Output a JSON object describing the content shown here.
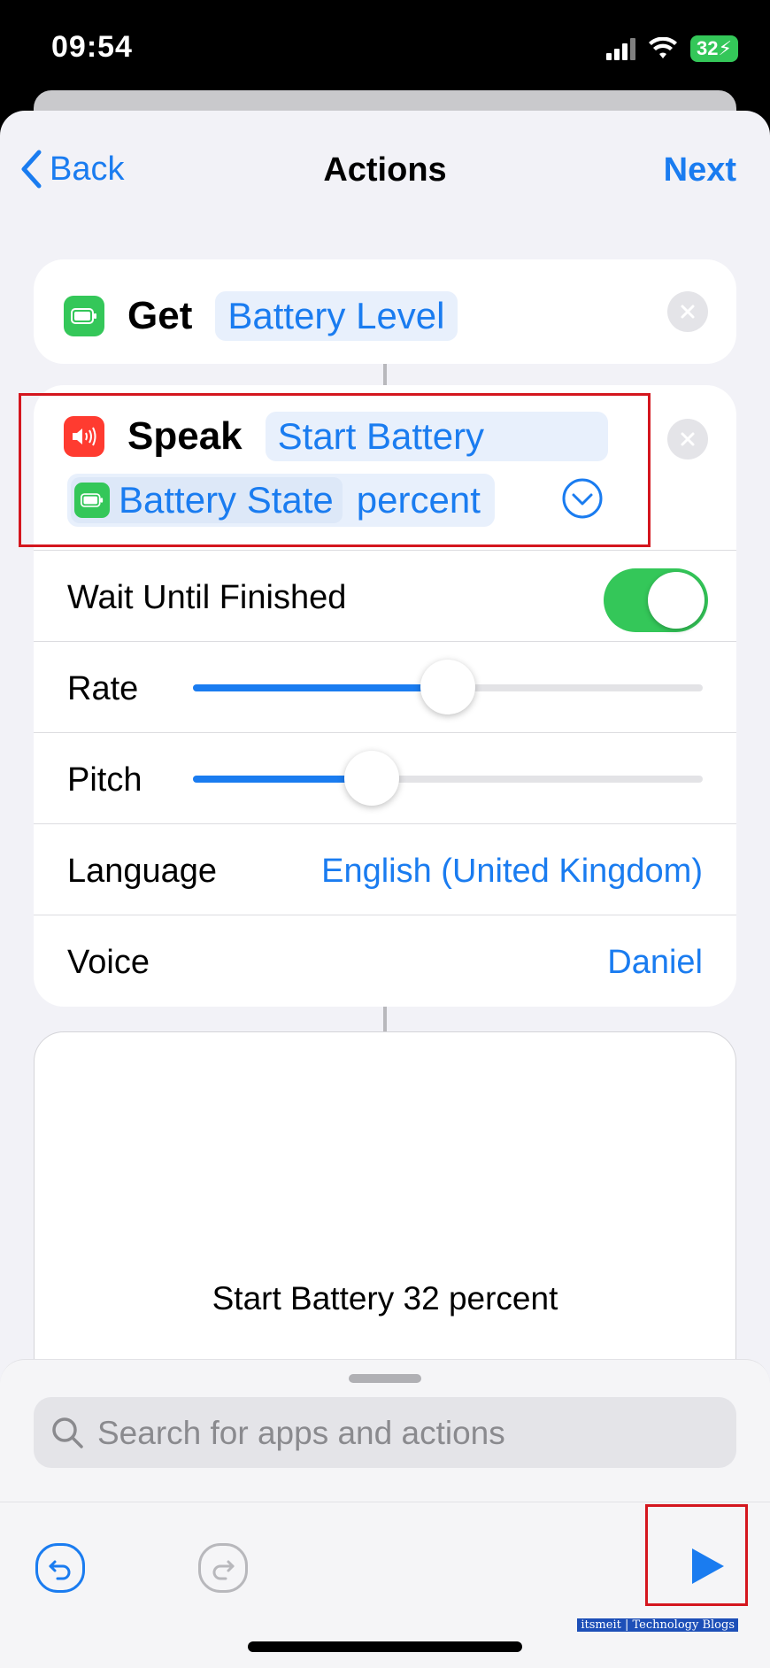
{
  "status_bar": {
    "time": "09:54",
    "battery_percent": "32"
  },
  "nav": {
    "back_label": "Back",
    "title": "Actions",
    "next_label": "Next"
  },
  "get_action": {
    "verb": "Get",
    "parameter": "Battery Level"
  },
  "speak_action": {
    "verb": "Speak",
    "text_part1": "Start Battery",
    "variable": "Battery State",
    "text_part2": "percent",
    "wait_label": "Wait Until Finished",
    "wait_enabled": true,
    "rate_label": "Rate",
    "rate_value": 0.5,
    "pitch_label": "Pitch",
    "pitch_value": 0.35,
    "language_label": "Language",
    "language_value": "English (United Kingdom)",
    "voice_label": "Voice",
    "voice_value": "Daniel"
  },
  "result": {
    "text": "Start Battery 32 percent"
  },
  "search": {
    "placeholder": "Search for apps and actions"
  },
  "watermark": "itsmeit | Technology Blogs",
  "colors": {
    "accent": "#1a7cf0",
    "green": "#34c759",
    "red": "#ff3b30",
    "highlight": "#d4161e"
  }
}
